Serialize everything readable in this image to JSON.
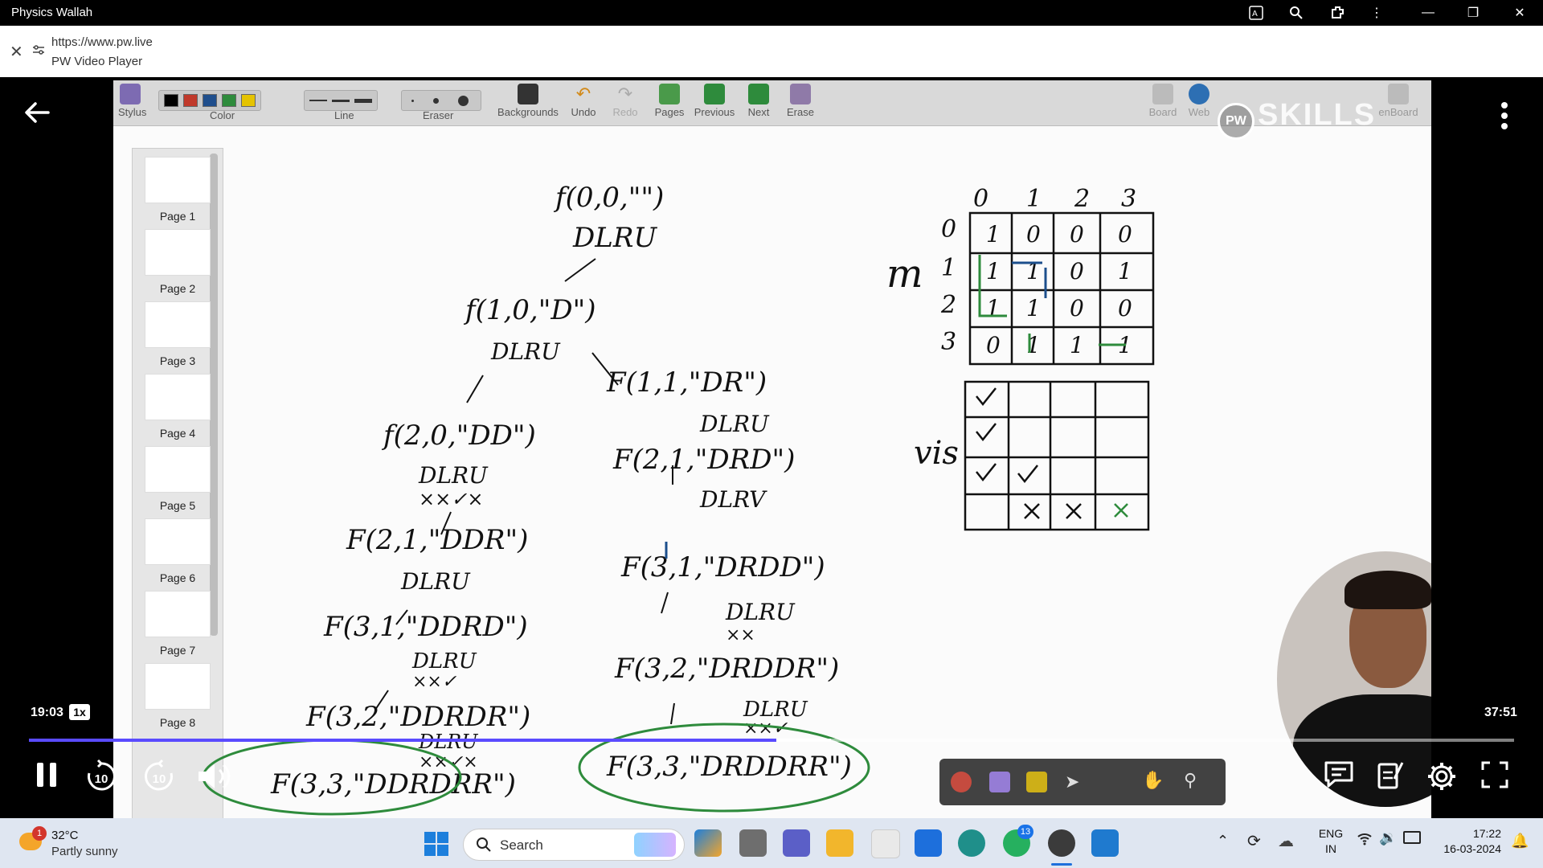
{
  "window": {
    "app_title": "Physics Wallah"
  },
  "address": {
    "url": "https://www.pw.live",
    "page_title": "PW Video Player"
  },
  "toolbar": {
    "stylus": "Stylus",
    "color": "Color",
    "line": "Line",
    "eraser": "Eraser",
    "backgrounds": "Backgrounds",
    "undo": "Undo",
    "redo": "Redo",
    "pages": "Pages",
    "previous": "Previous",
    "next": "Next",
    "erase": "Erase",
    "board": "Board",
    "web": "Web",
    "openboard": "enBoard",
    "colors": [
      "#000000",
      "#c0392b",
      "#1f4e8c",
      "#2e8b3c",
      "#e5c300"
    ]
  },
  "watermark": "SKILLS",
  "page_list": [
    {
      "label": "Page 1"
    },
    {
      "label": "Page 2"
    },
    {
      "label": "Page 3"
    },
    {
      "label": "Page 4"
    },
    {
      "label": "Page 5"
    },
    {
      "label": "Page 6"
    },
    {
      "label": "Page 7"
    },
    {
      "label": "Page 8"
    }
  ],
  "whiteboard": {
    "tree": [
      "f(0,0,\"\")",
      "DLRU",
      "f(1,0,\"D\")",
      "DLRU",
      "f(2,0,\"DD\")",
      "DLRU",
      "××✓×",
      "F(1,1,\"DR\")",
      "DLRU",
      "F(2,1,\"DRD\")",
      "DLRV",
      "F(2,1,\"DDR\")",
      "DLRU",
      "F(3,1,\"DDRD\")",
      "DLRU",
      "××✓",
      "F(3,2,\"DDRDR\")",
      "DLRU",
      "××✓×",
      "F(3,3,\"DDRDRR\")",
      "F(3,1,\"DRDD\")",
      "DLRU",
      "××",
      "F(3,2,\"DRDDR\")",
      "DLRU",
      "××✓",
      "F(3,3,\"DRDDRR\")"
    ],
    "grid_labels": {
      "cols": [
        "0",
        "1",
        "2",
        "3"
      ],
      "rows": [
        "0",
        "1",
        "2",
        "3"
      ],
      "m": "m",
      "vis": "vis"
    },
    "matrix": [
      [
        "1",
        "0",
        "0",
        "0"
      ],
      [
        "1",
        "1",
        "0",
        "1"
      ],
      [
        "1",
        "1",
        "0",
        "0"
      ],
      [
        "0",
        "1",
        "1",
        "1"
      ]
    ]
  },
  "player": {
    "current_time": "19:03",
    "duration": "37:51",
    "speed": "1x",
    "progress_fraction": 0.503,
    "buffered_fraction": 0.54,
    "rewind": "10",
    "forward": "10"
  },
  "taskbar": {
    "temp": "32°C",
    "weather": "Partly sunny",
    "weather_badge": "1",
    "search": "Search",
    "whatsapp_badge": "13",
    "lang_top": "ENG",
    "lang_bottom": "IN",
    "clock_time": "17:22",
    "clock_date": "16-03-2024"
  }
}
